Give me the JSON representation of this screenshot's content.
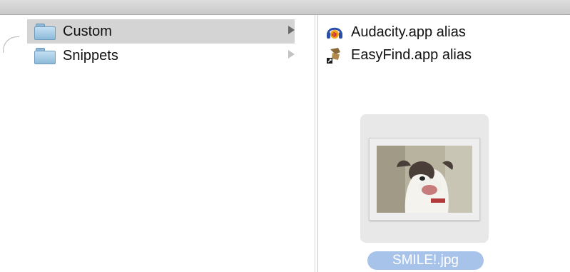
{
  "window": {
    "title_strip": "",
    "chrome_color": "#cfcfcf"
  },
  "left_column": {
    "items": [
      {
        "label": "Custom",
        "icon": "folder-icon",
        "selected": true,
        "has_children": true
      },
      {
        "label": "Snippets",
        "icon": "folder-icon",
        "selected": false,
        "has_children": true
      }
    ],
    "selection_color": "#d4d4d4"
  },
  "right_column": {
    "items": [
      {
        "label": "Audacity.app alias",
        "icon": "audacity-icon"
      },
      {
        "label": "EasyFind.app alias",
        "icon": "easyfind-icon"
      }
    ],
    "preview": {
      "filename": "SMILE!.jpg",
      "thumbnail": "dog-photo-thumbnail",
      "label_color": "#a8c3ea"
    }
  }
}
